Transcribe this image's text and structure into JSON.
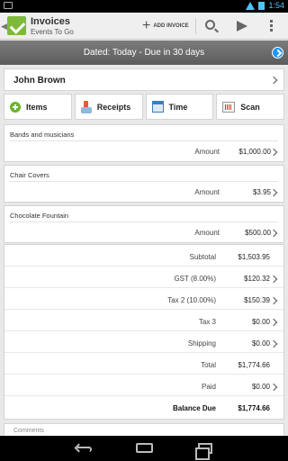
{
  "status_bar": {
    "time": "1:54"
  },
  "action_bar": {
    "title": "Invoices",
    "subtitle": "Events To Go",
    "add_invoice_label": "ADD INVOICE",
    "icons": [
      "back-icon",
      "app-logo-icon",
      "plus-icon",
      "search-icon",
      "send-icon",
      "overflow-menu-icon"
    ]
  },
  "dated_bar": {
    "text": "Dated: Today - Due in 30 days"
  },
  "client": {
    "name": "John Brown"
  },
  "tabs": [
    {
      "label": "Items",
      "icon": "add-circle-icon"
    },
    {
      "label": "Receipts",
      "icon": "receipt-icon"
    },
    {
      "label": "Time",
      "icon": "calendar-icon"
    },
    {
      "label": "Scan",
      "icon": "scan-icon"
    }
  ],
  "line_items": [
    {
      "name": "Bands and musicians",
      "amount_label": "Amount",
      "amount": "$1,000.00"
    },
    {
      "name": "Chair Covers",
      "amount_label": "Amount",
      "amount": "$3.95"
    },
    {
      "name": "Chocolate Fountain",
      "amount_label": "Amount",
      "amount": "$500.00"
    }
  ],
  "totals": [
    {
      "label": "Subtotal",
      "value": "$1,503.95"
    },
    {
      "label": "GST (8.00%)",
      "value": "$120.32"
    },
    {
      "label": "Tax 2 (10.00%)",
      "value": "$150.39"
    },
    {
      "label": "Tax 3",
      "value": "$0.00"
    },
    {
      "label": "Shipping",
      "value": "$0.00"
    },
    {
      "label": "Total",
      "value": "$1,774.66"
    },
    {
      "label": "Paid",
      "value": "$0.00"
    },
    {
      "label": "Balance Due",
      "value": "$1,774.66"
    }
  ],
  "comments": {
    "label": "Comments"
  },
  "colors": {
    "accent_green": "#7fb93a",
    "dated_bar": "#6b6b6b",
    "arrow_blue": "#2196f3"
  }
}
